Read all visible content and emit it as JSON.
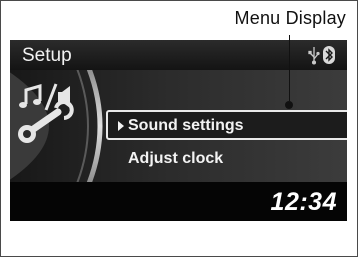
{
  "annotation": {
    "label": "Menu Display"
  },
  "screen": {
    "title": "Setup",
    "status_icons": [
      "usb-icon",
      "bluetooth-icon"
    ],
    "category_icon": "audio-settings-icon",
    "menu": {
      "selected": "Sound settings",
      "items": [
        "Sound settings",
        "Adjust clock"
      ]
    },
    "clock": "12:34"
  },
  "colors": {
    "screen_bg": "#0c0c0c",
    "text": "#f3f3f3",
    "highlight_border": "#e9e9e9"
  }
}
